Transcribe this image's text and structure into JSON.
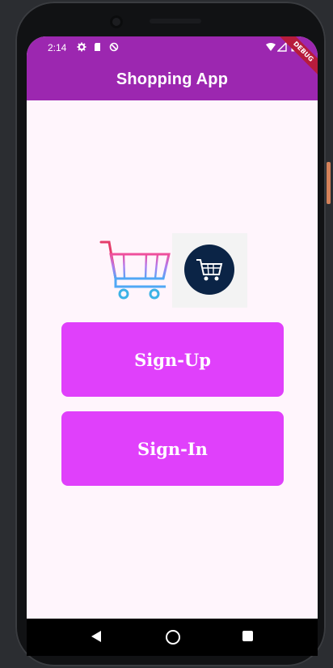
{
  "status_bar": {
    "time": "2:14",
    "icons": [
      "gear-icon",
      "sd-card-icon",
      "data-saver-icon",
      "wifi-icon",
      "signal-icon",
      "battery-icon"
    ],
    "background_color": "#9c27b0"
  },
  "app_bar": {
    "title": "Shopping App",
    "background_color": "#9c27b0"
  },
  "debug_banner": {
    "label": "DEBUG"
  },
  "logos": [
    "shopping-cart-logo",
    "dark-circle-cart-logo"
  ],
  "buttons": {
    "sign_up": "Sign-Up",
    "sign_in": "Sign-In",
    "color": "#e040fb"
  },
  "nav_bar": {
    "icons": [
      "back-icon",
      "home-icon",
      "recents-icon"
    ]
  },
  "colors": {
    "screen_background": "#fff5fc",
    "button": "#e040fb",
    "app_bar": "#9c27b0"
  }
}
